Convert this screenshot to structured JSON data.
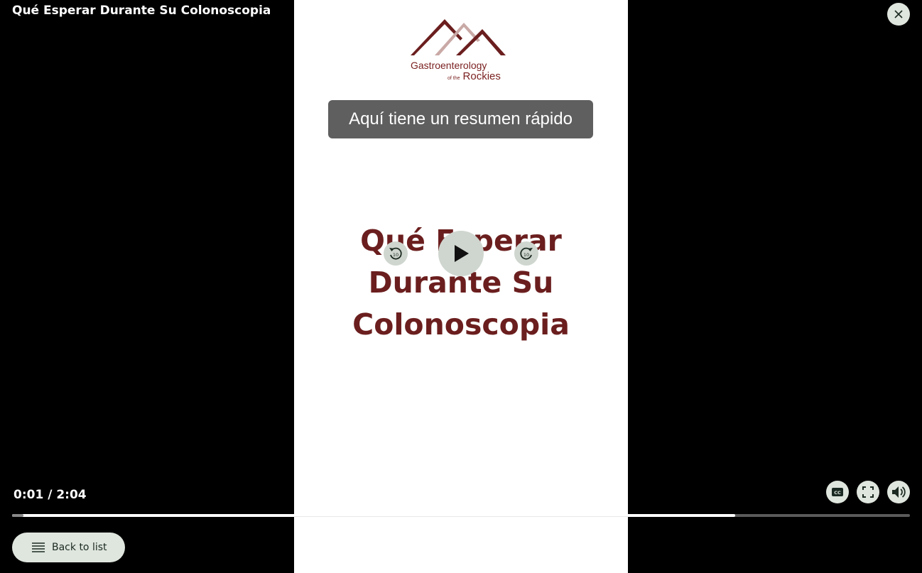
{
  "header": {
    "title": "Qué Esperar Durante Su Colonoscopia"
  },
  "video": {
    "logo": {
      "line1": "Gastroenterology",
      "line2_small": "of the",
      "line2_big": "Rockies"
    },
    "caption": "Aquí tiene un resumen rápido",
    "title_lines": [
      "Qué Esperar",
      "Durante Su",
      "Colonoscopia"
    ],
    "skip_back_seconds": "10",
    "skip_forward_seconds": "10",
    "brand_color": "#6b1e1e"
  },
  "player": {
    "time_display": "0:01 / 2:04",
    "current_time": "0:01",
    "duration": "2:04",
    "progress_fraction": 0.805,
    "back_label": "Back to list",
    "icons": [
      "close-icon",
      "rewind-10-icon",
      "play-icon",
      "forward-10-icon",
      "closed-captions-icon",
      "fullscreen-icon",
      "volume-icon",
      "list-icon"
    ]
  }
}
